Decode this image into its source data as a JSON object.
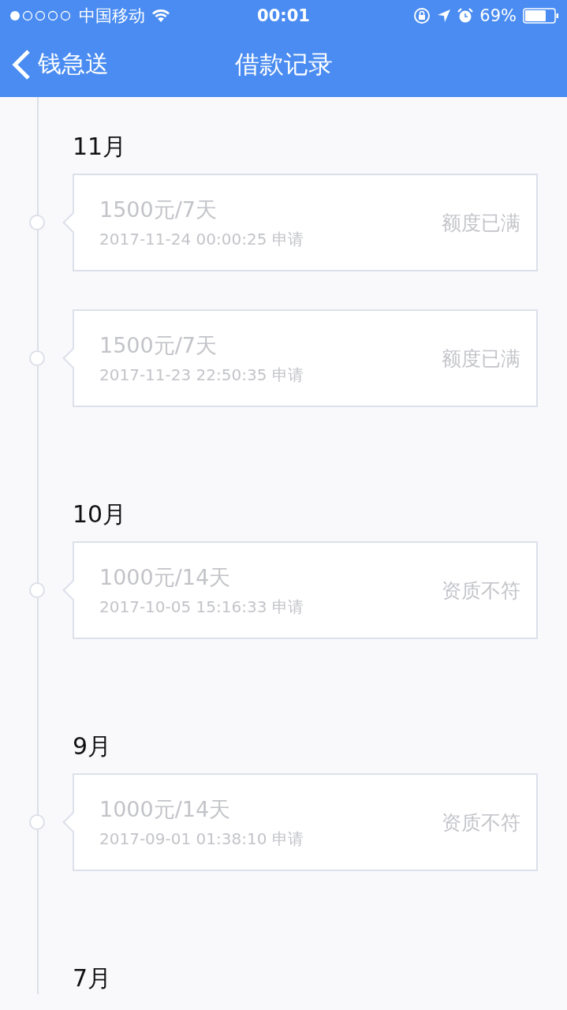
{
  "status_bar": {
    "carrier": "中国移动",
    "time": "00:01",
    "battery": "69%"
  },
  "nav": {
    "back": "钱急送",
    "title": "借款记录"
  },
  "groups": [
    {
      "month": "11月",
      "records": [
        {
          "amount": "1500元/7天",
          "date": "2017-11-24 00:00:25 申请",
          "status": "额度已满"
        },
        {
          "amount": "1500元/7天",
          "date": "2017-11-23 22:50:35 申请",
          "status": "额度已满"
        }
      ]
    },
    {
      "month": "10月",
      "records": [
        {
          "amount": "1000元/14天",
          "date": "2017-10-05 15:16:33 申请",
          "status": "资质不符"
        }
      ]
    },
    {
      "month": "9月",
      "records": [
        {
          "amount": "1000元/14天",
          "date": "2017-09-01 01:38:10 申请",
          "status": "资质不符"
        }
      ]
    },
    {
      "month": "7月"
    }
  ]
}
